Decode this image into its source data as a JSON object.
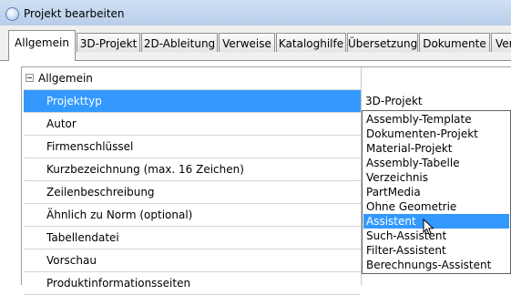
{
  "window": {
    "title": "Projekt bearbeiten"
  },
  "tabs": [
    {
      "label": "Allgemein"
    },
    {
      "label": "3D-Projekt"
    },
    {
      "label": "2D-Ableitung"
    },
    {
      "label": "Verweise"
    },
    {
      "label": "Kataloghilfe"
    },
    {
      "label": "Übersetzung"
    },
    {
      "label": "Dokumente"
    },
    {
      "label": "Ver"
    }
  ],
  "grid": {
    "group": {
      "label": "Allgemein"
    },
    "rows": [
      {
        "label": "Projekttyp"
      },
      {
        "label": "Autor"
      },
      {
        "label": "Firmenschlüssel"
      },
      {
        "label": "Kurzbezeichnung (max. 16 Zeichen)"
      },
      {
        "label": "Zeilenbeschreibung"
      },
      {
        "label": "Ähnlich zu Norm (optional)"
      },
      {
        "label": "Tabellendatei"
      },
      {
        "label": "Vorschau"
      },
      {
        "label": "Produktinformationsseiten"
      }
    ],
    "selected_value": "3D-Projekt"
  },
  "dropdown": {
    "options": [
      "Assembly-Template",
      "Dokumenten-Projekt",
      "Material-Projekt",
      "Assembly-Tabelle",
      "Verzeichnis",
      "PartMedia",
      "Ohne Geometrie",
      "Assistent",
      "Such-Assistent",
      "Filter-Assistent",
      "Berechnungs-Assistent"
    ],
    "highlighted": "Assistent"
  },
  "colors": {
    "selection": "#3399ff",
    "titlebar": "#cfe0f4"
  }
}
